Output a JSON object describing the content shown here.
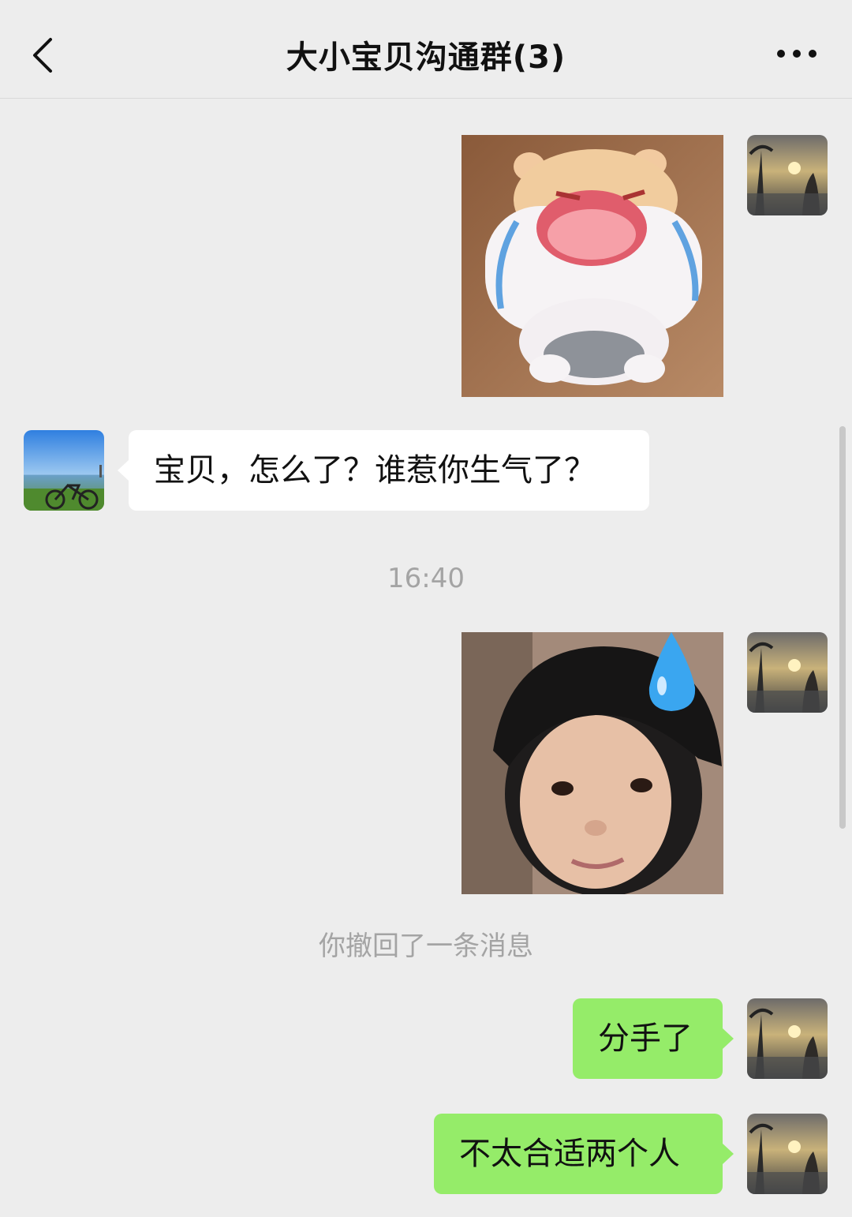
{
  "header": {
    "title": "大小宝贝沟通群(3)"
  },
  "messages": {
    "incoming_text": "宝贝，怎么了？谁惹你生气了？",
    "timestamp": "16:40",
    "recall_notice": "你撤回了一条消息",
    "outgoing_text_1": "分手了",
    "outgoing_text_2": "不太合适两个人"
  },
  "icons": {
    "back": "back-arrow-icon",
    "more": "more-dots-icon"
  },
  "colors": {
    "background": "#ededed",
    "outgoing_bubble": "#95ec69",
    "incoming_bubble": "#ffffff",
    "system_text": "#a4a4a4"
  }
}
